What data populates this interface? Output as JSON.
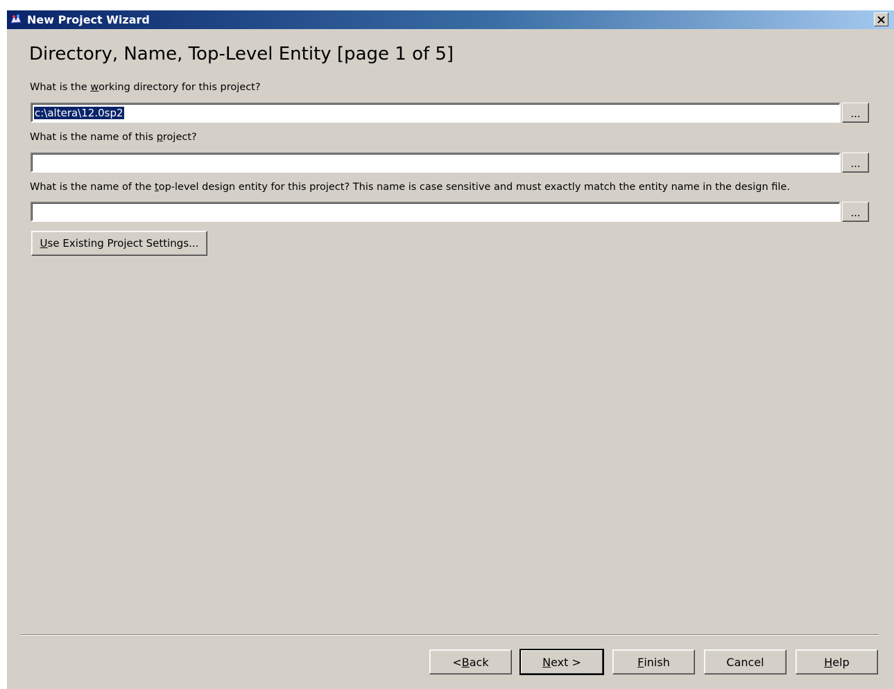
{
  "window": {
    "title": "New Project Wizard",
    "icon": "quartus-app-icon",
    "close_icon": "close-icon"
  },
  "page": {
    "heading": "Directory, Name, Top-Level Entity [page 1 of 5]"
  },
  "fields": {
    "directory": {
      "label_pre": "What is the ",
      "label_mnemonic": "w",
      "label_post": "orking directory for this project?",
      "value": "c:\\altera\\12.0sp2",
      "browse_label": "..."
    },
    "project_name": {
      "label_pre": "What is the name of this ",
      "label_mnemonic": "p",
      "label_post": "roject?",
      "value": "",
      "browse_label": "..."
    },
    "top_level": {
      "label_pre": "What is the name of the ",
      "label_mnemonic": "t",
      "label_post": "op-level design entity for this project? This name is case sensitive and must exactly match the entity name in the design file.",
      "value": "",
      "browse_label": "..."
    }
  },
  "existing_settings": {
    "mnemonic": "U",
    "label_rest": "se Existing Project Settings..."
  },
  "footer": {
    "back": {
      "pre": "< ",
      "mnemonic": "B",
      "post": "ack"
    },
    "next": {
      "pre": "",
      "mnemonic": "N",
      "post": "ext >"
    },
    "finish": {
      "pre": "",
      "mnemonic": "F",
      "post": "inish"
    },
    "cancel": {
      "pre": "Cancel",
      "mnemonic": "",
      "post": ""
    },
    "help": {
      "pre": "",
      "mnemonic": "H",
      "post": "elp"
    }
  }
}
